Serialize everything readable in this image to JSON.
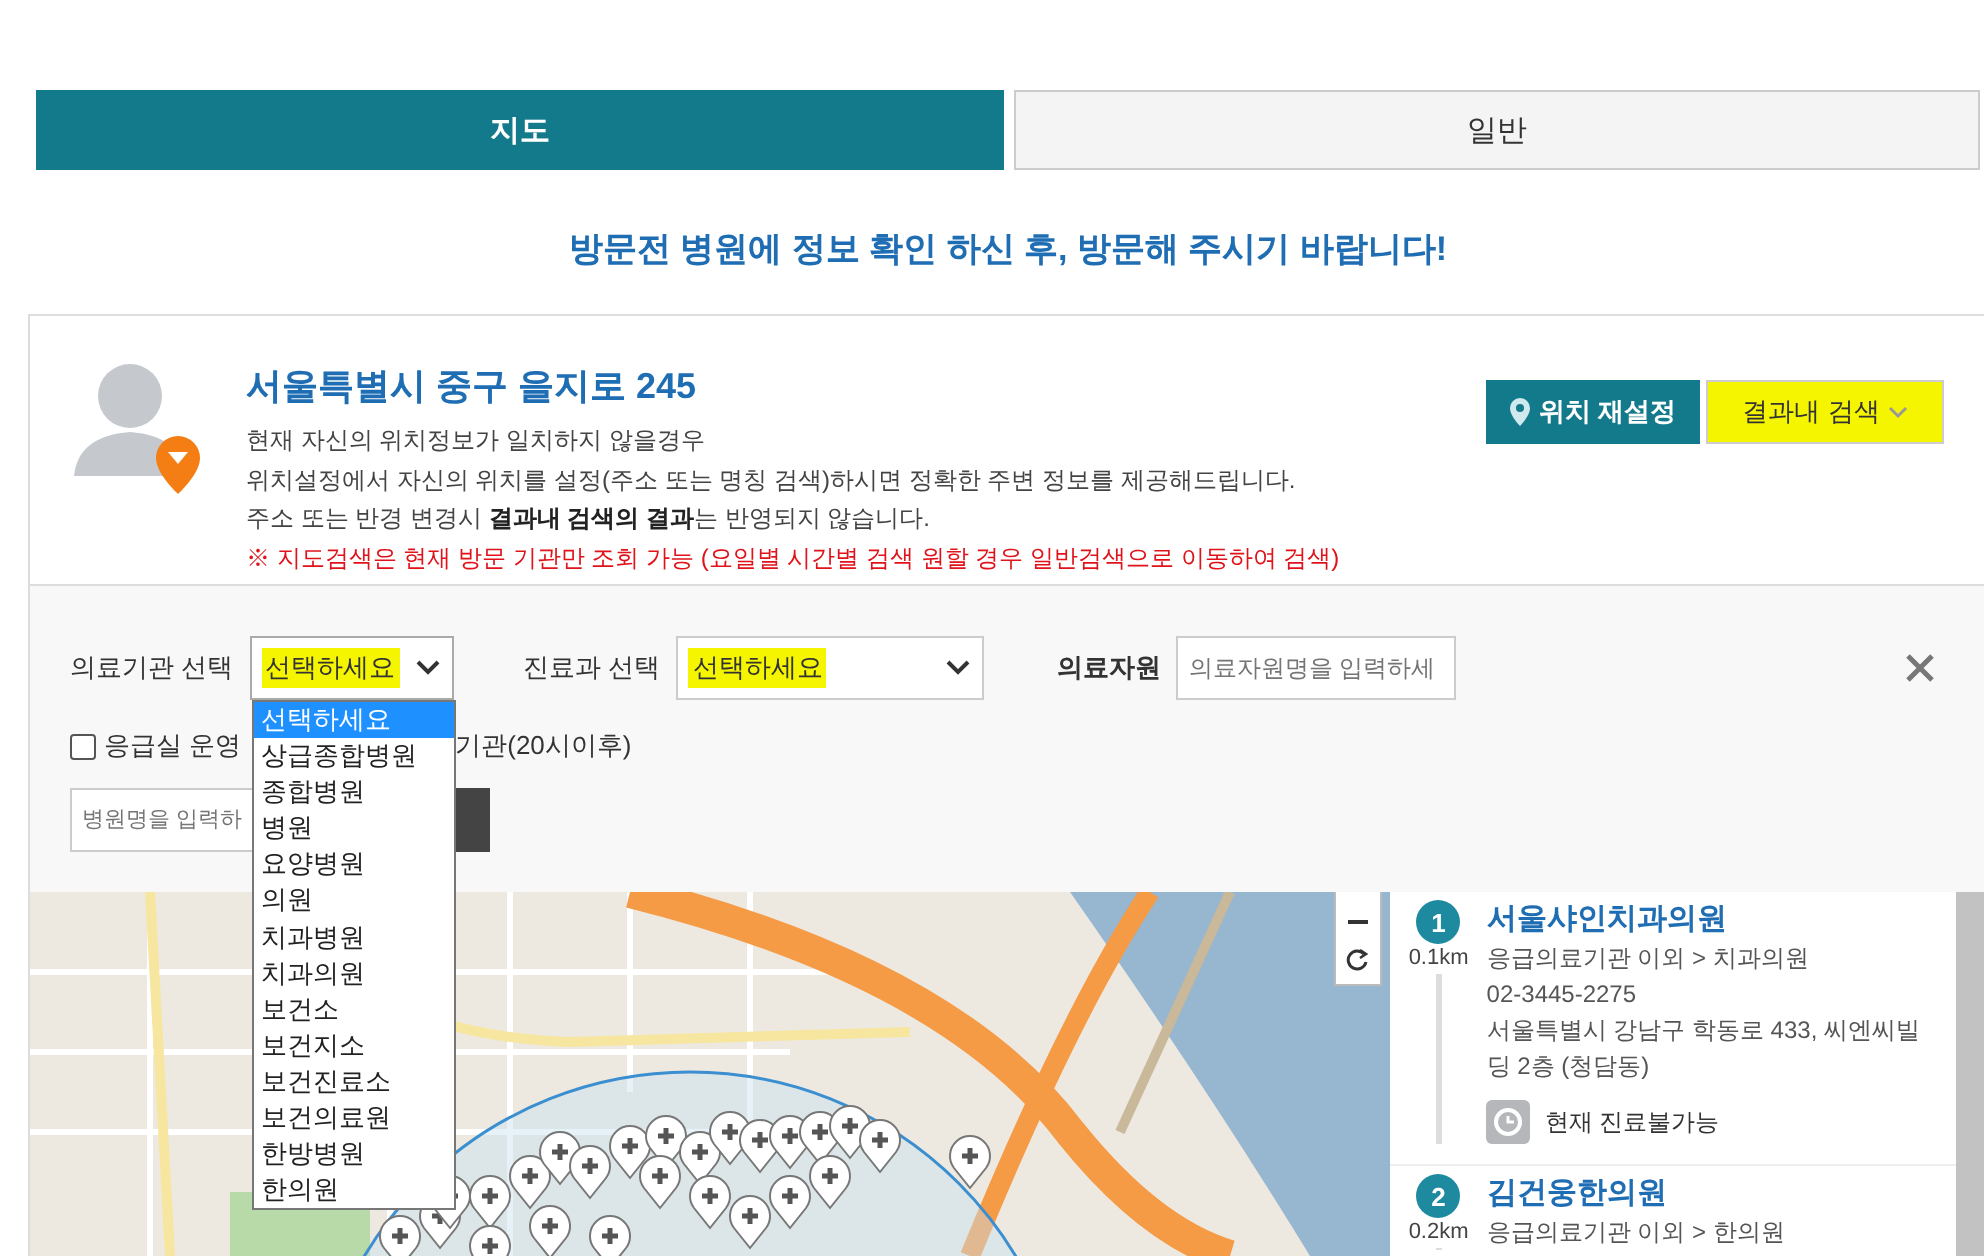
{
  "tabs": [
    {
      "label": "지도",
      "selected": true
    },
    {
      "label": "일반",
      "selected": false
    }
  ],
  "notice": "방문전 병원에 정보 확인 하신 후, 방문해 주시기 바랍니다!",
  "location": {
    "address": "서울특별시 중구 을지로 245",
    "lines": [
      "현재 자신의 위치정보가 일치하지 않을경우",
      "위치설정에서 자신의 위치를 설정(주소 또는 명칭 검색)하시면 정확한 주변 정보를 제공해드립니다.",
      "주소 또는 반경 변경시 **결과내 검색의 결과**는 반영되지 않습니다."
    ],
    "warning": "※ 지도검색은 현재 방문 기관만 조회 가능 (요일별 시간별 검색 원할 경우 일반검색으로 이동하여 검색)",
    "reset_button": "위치 재설정",
    "filter_button": {
      "label": "결과내 검색",
      "highlighted": true
    }
  },
  "filters": {
    "institution": {
      "label": "의료기관 선택",
      "value": "선택하세요",
      "highlighted": true,
      "expanded": true,
      "options": [
        {
          "label": "선택하세요",
          "selected": true
        },
        {
          "label": "상급종합병원",
          "selected": false
        },
        {
          "label": "종합병원",
          "selected": false
        },
        {
          "label": "병원",
          "selected": false
        },
        {
          "label": "요양병원",
          "selected": false
        },
        {
          "label": "의원",
          "selected": false
        },
        {
          "label": "치과병원",
          "selected": false
        },
        {
          "label": "치과의원",
          "selected": false
        },
        {
          "label": "보건소",
          "selected": false
        },
        {
          "label": "보건지소",
          "selected": false
        },
        {
          "label": "보건진료소",
          "selected": false
        },
        {
          "label": "보건의료원",
          "selected": false
        },
        {
          "label": "한방병원",
          "selected": false
        },
        {
          "label": "한의원",
          "selected": false
        }
      ]
    },
    "department": {
      "label": "진료과 선택",
      "value": "선택하세요",
      "highlighted": true
    },
    "resource": {
      "label": "의료자원",
      "placeholder": "의료자원명을 입력하세"
    },
    "emergency": {
      "label": "응급실 운영",
      "checked": false
    },
    "night_label": "기관(20시이후)",
    "name_search": {
      "placeholder": "병원명을 입력하"
    }
  },
  "results": [
    {
      "number": "1",
      "name": "서울샤인치과의원",
      "distance": "0.1km",
      "category": "응급의료기관 이외 > 치과의원",
      "phone": "02-3445-2275",
      "address": "서울특별시 강남구 학동로 433, 씨엔씨빌딩 2층 (청담동)",
      "status": "현재 진료불가능"
    },
    {
      "number": "2",
      "name": "김건웅한의원",
      "distance": "0.2km",
      "category": "응급의료기관 이외 > 한의원"
    }
  ]
}
